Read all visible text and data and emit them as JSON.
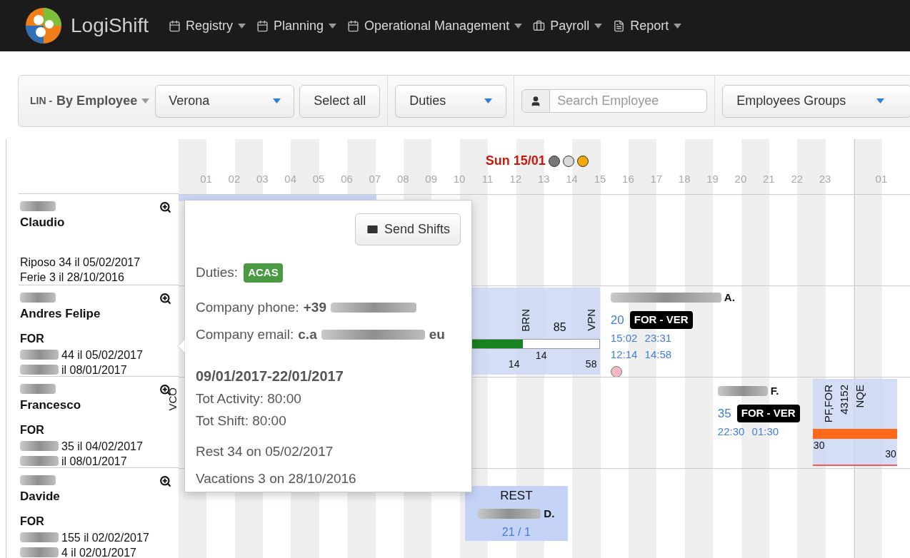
{
  "navbar": {
    "brand": "LogiShift",
    "menu": [
      {
        "label": "Registry"
      },
      {
        "label": "Planning"
      },
      {
        "label": "Operational Management"
      },
      {
        "label": "Payroll"
      },
      {
        "label": "Report"
      }
    ]
  },
  "toolbar": {
    "view": {
      "prefix": "LIN -",
      "label": "By Employee"
    },
    "location": "Verona",
    "select_all": "Select all",
    "duties": "Duties",
    "search": {
      "placeholder": "Search Employee"
    },
    "groups": "Employees Groups"
  },
  "timeline": {
    "date": "Sun 15/01",
    "status_dots": [
      {
        "color": "#777777"
      },
      {
        "color": "#d9d9d9"
      },
      {
        "color": "#f5a800"
      }
    ],
    "hours": [
      "01",
      "02",
      "03",
      "04",
      "05",
      "06",
      "07",
      "08",
      "09",
      "10",
      "11",
      "12",
      "13",
      "14",
      "15",
      "16",
      "17",
      "18",
      "19",
      "20",
      "21",
      "22",
      "23"
    ],
    "next_day_hours": [
      "01"
    ],
    "employees": [
      {
        "first_name": "Claudio",
        "counters": [
          {
            "text": "Riposo 34 il 05/02/2017",
            "redacted_prefix": false
          },
          {
            "text": "Ferie 3 il 28/10/2016",
            "redacted_prefix": false
          }
        ]
      },
      {
        "first_name": "Andres Felipe",
        "role": "FOR",
        "counters": [
          {
            "text": "44 il 05/02/2017",
            "redacted_prefix": true
          },
          {
            "text": "il 08/01/2017",
            "redacted_prefix": true
          }
        ]
      },
      {
        "first_name": "Francesco",
        "role": "FOR",
        "counters": [
          {
            "text": "35 il 04/02/2017",
            "redacted_prefix": true
          },
          {
            "text": "il 08/01/2017",
            "redacted_prefix": true
          }
        ]
      },
      {
        "first_name": "Davide",
        "role": "FOR",
        "counters": [
          {
            "text": "155 il 02/02/2017",
            "redacted_prefix": true
          },
          {
            "text": "4 il 02/01/2017",
            "redacted_prefix": true
          }
        ]
      }
    ],
    "rows": [
      {
        "items": [
          {
            "kind": "plain"
          }
        ]
      },
      {
        "items": [
          {
            "kind": "activity",
            "vertical_labels": [
              "BRN",
              "VPN"
            ],
            "value": "85",
            "level": 0.63,
            "numbers": [
              "14",
              "14",
              "58"
            ]
          },
          {
            "kind": "assignment",
            "name_suffix": "A.",
            "count": "20",
            "badge": "FOR - VER",
            "times": [
              "15:02 23:31",
              "12:14 14:58"
            ],
            "warning": true
          }
        ]
      },
      {
        "items": [
          {
            "kind": "label",
            "text": "VCO"
          },
          {
            "kind": "assignment",
            "name_suffix": "F.",
            "count": "35",
            "badge": "FOR - VER",
            "times": [
              "22:30 01:30"
            ],
            "warning": false
          },
          {
            "kind": "activity",
            "vertical_labels": [
              "PF,FOR",
              "43152",
              "NQE"
            ],
            "value": null,
            "numbers": [
              "30",
              "30"
            ]
          }
        ]
      },
      {
        "items": [
          {
            "kind": "rest",
            "title": "REST",
            "name_suffix": "D.",
            "count": "21 / 1"
          }
        ]
      }
    ]
  },
  "popover": {
    "button": "Send Shifts",
    "duties_label": "Duties:",
    "duty": "ACAS",
    "phone_label": "Company phone:",
    "phone_visible": "+39",
    "email_label": "Company email:",
    "email_start": "c.a",
    "email_end": "eu",
    "period": "09/01/2017-22/01/2017",
    "tot_activity": "Tot Activity: 80:00",
    "tot_shift": "Tot Shift: 80:00",
    "rest": "Rest 34 on 05/02/2017",
    "vacations": "Vacations 3 on 28/10/2016"
  }
}
